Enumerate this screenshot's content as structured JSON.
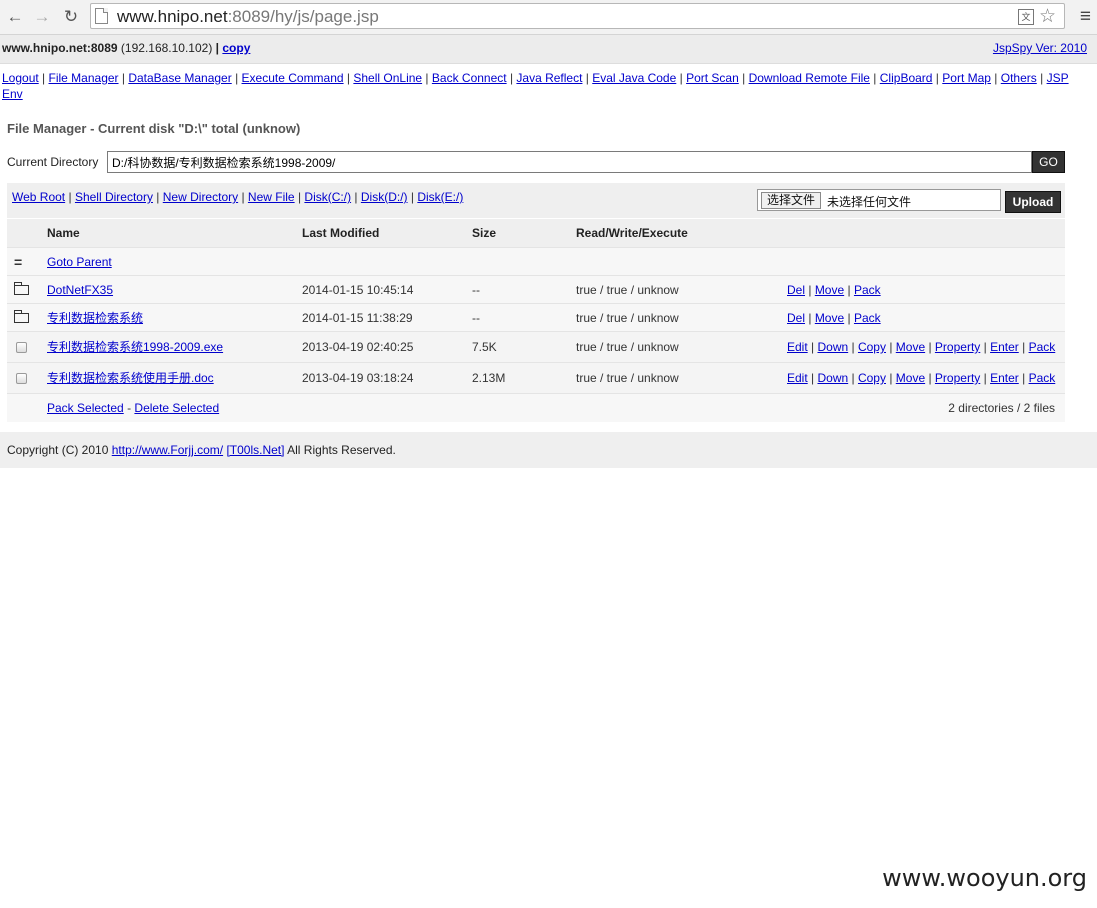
{
  "browser": {
    "url_host": "www.hnipo.net",
    "url_rest": ":8089/hy/js/page.jsp"
  },
  "header": {
    "host": "www.hnipo.net:8089",
    "ip": "(192.168.10.102)",
    "sep": "|",
    "copy": "copy",
    "version": "JspSpy Ver: 2010"
  },
  "menu": [
    "Logout",
    "File Manager",
    "DataBase Manager",
    "Execute Command",
    "Shell OnLine",
    "Back Connect",
    "Java Reflect",
    "Eval Java Code",
    "Port Scan",
    "Download Remote File",
    "ClipBoard",
    "Port Map",
    "Others",
    "JSP Env"
  ],
  "title": "File Manager - Current disk \"D:\\\" total (unknow)",
  "curdir": {
    "label": "Current Directory",
    "value": "D:/科协数据/专利数据检索系统1998-2009/",
    "go": "GO"
  },
  "toolbar": {
    "links": [
      "Web Root",
      "Shell Directory",
      "New Directory",
      "New File",
      "Disk(C:/)",
      "Disk(D:/)",
      "Disk(E:/)"
    ],
    "choose_file": "选择文件",
    "no_file": "未选择任何文件",
    "upload": "Upload"
  },
  "table": {
    "headers": {
      "name": "Name",
      "modified": "Last Modified",
      "size": "Size",
      "rwx": "Read/Write/Execute"
    },
    "parent": {
      "icon": "=",
      "label": "Goto Parent"
    },
    "dirs": [
      {
        "name": "DotNetFX35",
        "modified": "2014-01-15 10:45:14",
        "size": "--",
        "rwx": "true / true / unknow",
        "actions": [
          "Del",
          "Move",
          "Pack"
        ]
      },
      {
        "name": "专利数据检索系统",
        "modified": "2014-01-15 11:38:29",
        "size": "--",
        "rwx": "true / true / unknow",
        "actions": [
          "Del",
          "Move",
          "Pack"
        ]
      }
    ],
    "files": [
      {
        "name": "专利数据检索系统1998-2009.exe",
        "modified": "2013-04-19 02:40:25",
        "size": "7.5K",
        "rwx": "true / true / unknow",
        "actions": [
          "Edit",
          "Down",
          "Copy",
          "Move",
          "Property",
          "Enter",
          "Pack"
        ]
      },
      {
        "name": "专利数据检索系统使用手册.doc",
        "modified": "2013-04-19 03:18:24",
        "size": "2.13M",
        "rwx": "true / true / unknow",
        "actions": [
          "Edit",
          "Down",
          "Copy",
          "Move",
          "Property",
          "Enter",
          "Pack"
        ]
      }
    ],
    "footer": {
      "pack": "Pack Selected",
      "dash": "-",
      "delete": "Delete Selected",
      "count": "2 directories / 2 files"
    }
  },
  "copyright": {
    "prefix": "Copyright (C) 2010",
    "link1": "http://www.Forjj.com/",
    "link2": "[T00ls.Net]",
    "suffix": "All Rights Reserved."
  },
  "watermark": "www.wooyun.org"
}
